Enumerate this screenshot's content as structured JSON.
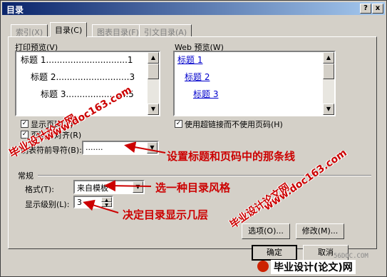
{
  "window": {
    "title": "目录",
    "help_label": "?",
    "close_label": "x"
  },
  "tabs": [
    {
      "label": "索引(X)",
      "active": false
    },
    {
      "label": "目录(C)",
      "active": true
    },
    {
      "label": "图表目录(F)",
      "active": false
    },
    {
      "label": "引文目录(A)",
      "active": false
    }
  ],
  "print_preview": {
    "label": "打印预览(V)",
    "lines": [
      "标题 1..............................1",
      "标题 2...........................3",
      "标题 3.......................5"
    ]
  },
  "web_preview": {
    "label": "Web 预览(W)",
    "links": [
      "标题 1",
      "标题 2",
      "标题 3"
    ]
  },
  "options": {
    "show_page_numbers": "显示页码(S)",
    "right_align": "页码右对齐(R)",
    "tab_leader_label": "制表符前导符(B):",
    "tab_leader_value": ".......",
    "hyperlinks": "使用超链接而不使用页码(H)"
  },
  "general": {
    "section_label": "常规",
    "format_label": "格式(T):",
    "format_value": "来自模板",
    "levels_label": "显示级别(L):",
    "levels_value": "3"
  },
  "buttons": {
    "options": "选项(O)...",
    "modify": "修改(M)...",
    "ok": "确定",
    "cancel": "取消"
  },
  "annotations": {
    "leader": "设置标题和页码中的",
    "leader_tail": "那条线",
    "format": "选一种目录风格",
    "levels": "决定目录显示几层"
  },
  "watermarks": {
    "site_cn": "毕业设计论文网",
    "site_url": "www.doc163.com"
  },
  "footer": {
    "logo_text": "毕业设计(论文)网",
    "domain": "56DOC.COM"
  },
  "colors": {
    "accent": "#cc0000",
    "titlebar": "#0a246a",
    "link": "#0000cc"
  }
}
